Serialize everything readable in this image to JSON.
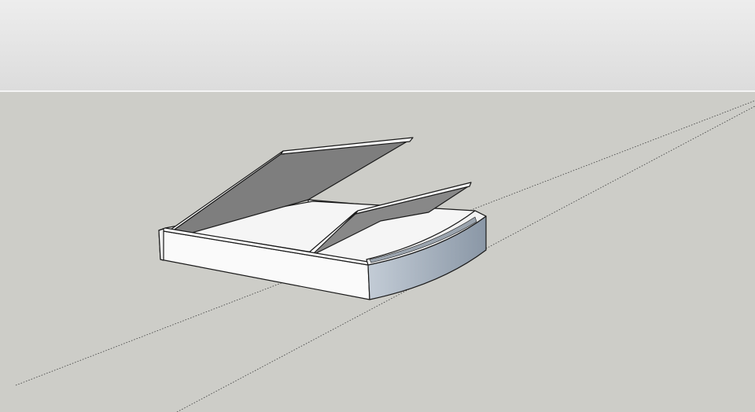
{
  "app": {
    "kind": "3d-modeling-viewport"
  },
  "scene": {
    "sky_top_color": "#ededed",
    "sky_bottom_color": "#dcdcdc",
    "ground_color": "#cdcdc8",
    "horizon_line_color": "#ffffff",
    "edge_color": "#1a1a1a",
    "axis_line_color": "#3a3a3a",
    "model": {
      "name": "storage-bed-frame",
      "face_white": "#fafafa",
      "face_inner_shadow": "#e9e9e9",
      "face_floor": "#8c8c8c",
      "lid_underside": "#7e7e7e",
      "curved_front_light": "#c3ccd6",
      "curved_front_dark": "#8a97a6",
      "large_lid": "open",
      "small_lid": "open"
    }
  }
}
